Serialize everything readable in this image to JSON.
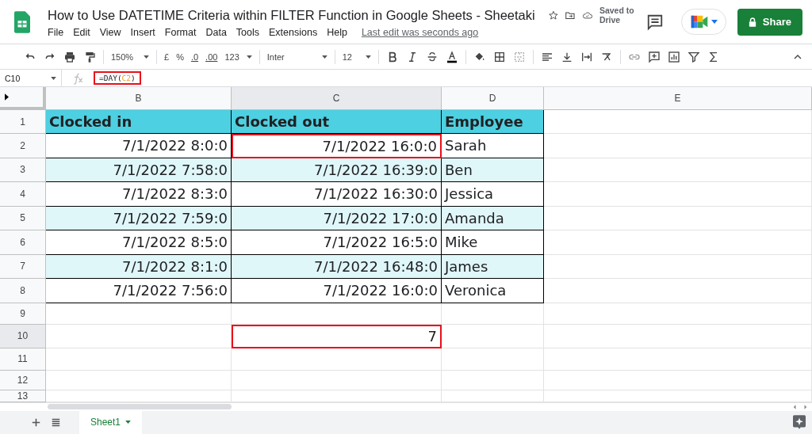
{
  "document": {
    "title": "How to Use DATETIME Criteria within FILTER Function in Google Sheets - Sheetaki",
    "save_status": "Saved to Drive",
    "last_edit": "Last edit was seconds ago",
    "share": "Share"
  },
  "menu": [
    "File",
    "Edit",
    "View",
    "Insert",
    "Format",
    "Data",
    "Tools",
    "Extensions",
    "Help"
  ],
  "toolbar": {
    "zoom": "150%",
    "currency": "£",
    "percent": "%",
    "decrease_decimals": ".0",
    "increase_decimals": ".00",
    "number_format": "123",
    "font": "Inter",
    "font_size": "12"
  },
  "formula_bar": {
    "cell": "C10",
    "formula": [
      {
        "text": "=DAY(",
        "kind": "plain"
      },
      {
        "text": "C2",
        "kind": "ref"
      },
      {
        "text": ")",
        "kind": "plain"
      }
    ]
  },
  "columns": [
    {
      "label": "B",
      "selected": false
    },
    {
      "label": "C",
      "selected": true
    },
    {
      "label": "D",
      "selected": false
    },
    {
      "label": "E",
      "selected": false
    }
  ],
  "rows": [
    {
      "number": "1",
      "selected": false,
      "kind": "header",
      "shaded": true,
      "cells": [
        {
          "text": "Clocked in",
          "outlined": false
        },
        {
          "text": "Clocked out",
          "outlined": false
        },
        {
          "text": "Employee",
          "outlined": false
        }
      ]
    },
    {
      "number": "2",
      "selected": false,
      "kind": "data",
      "shaded": false,
      "cells": [
        {
          "text": "7/1/2022 8:0:0",
          "outlined": false
        },
        {
          "text": "7/1/2022 16:0:0",
          "outlined": true
        },
        {
          "text": "Sarah",
          "outlined": false
        }
      ]
    },
    {
      "number": "3",
      "selected": false,
      "kind": "data",
      "shaded": true,
      "cells": [
        {
          "text": "7/1/2022 7:58:0",
          "outlined": false
        },
        {
          "text": "7/1/2022 16:39:0",
          "outlined": false
        },
        {
          "text": "Ben",
          "outlined": false
        }
      ]
    },
    {
      "number": "4",
      "selected": false,
      "kind": "data",
      "shaded": false,
      "cells": [
        {
          "text": "7/1/2022 8:3:0",
          "outlined": false
        },
        {
          "text": "7/1/2022 16:30:0",
          "outlined": false
        },
        {
          "text": "Jessica",
          "outlined": false
        }
      ]
    },
    {
      "number": "5",
      "selected": false,
      "kind": "data",
      "shaded": true,
      "cells": [
        {
          "text": "7/1/2022 7:59:0",
          "outlined": false
        },
        {
          "text": "7/1/2022 17:0:0",
          "outlined": false
        },
        {
          "text": "Amanda",
          "outlined": false
        }
      ]
    },
    {
      "number": "6",
      "selected": false,
      "kind": "data",
      "shaded": false,
      "cells": [
        {
          "text": "7/1/2022 8:5:0",
          "outlined": false
        },
        {
          "text": "7/1/2022 16:5:0",
          "outlined": false
        },
        {
          "text": "Mike",
          "outlined": false
        }
      ]
    },
    {
      "number": "7",
      "selected": false,
      "kind": "data",
      "shaded": true,
      "cells": [
        {
          "text": "7/1/2022 8:1:0",
          "outlined": false
        },
        {
          "text": "7/1/2022 16:48:0",
          "outlined": false
        },
        {
          "text": "James",
          "outlined": false
        }
      ]
    },
    {
      "number": "8",
      "selected": false,
      "kind": "data",
      "shaded": false,
      "cells": [
        {
          "text": "7/1/2022 7:56:0",
          "outlined": false
        },
        {
          "text": "7/1/2022 16:0:0",
          "outlined": false
        },
        {
          "text": "Veronica",
          "outlined": false
        }
      ]
    },
    {
      "number": "9",
      "selected": false,
      "kind": "blank"
    },
    {
      "number": "10",
      "selected": true,
      "kind": "result",
      "cells": [
        {
          "text": "7",
          "outlined": true
        }
      ]
    },
    {
      "number": "11",
      "selected": false,
      "kind": "blank"
    },
    {
      "number": "12",
      "selected": false,
      "kind": "blank"
    },
    {
      "number": "13",
      "selected": false,
      "kind": "blank"
    }
  ],
  "sheets": [
    {
      "name": "Sheet1",
      "selected": true
    }
  ]
}
